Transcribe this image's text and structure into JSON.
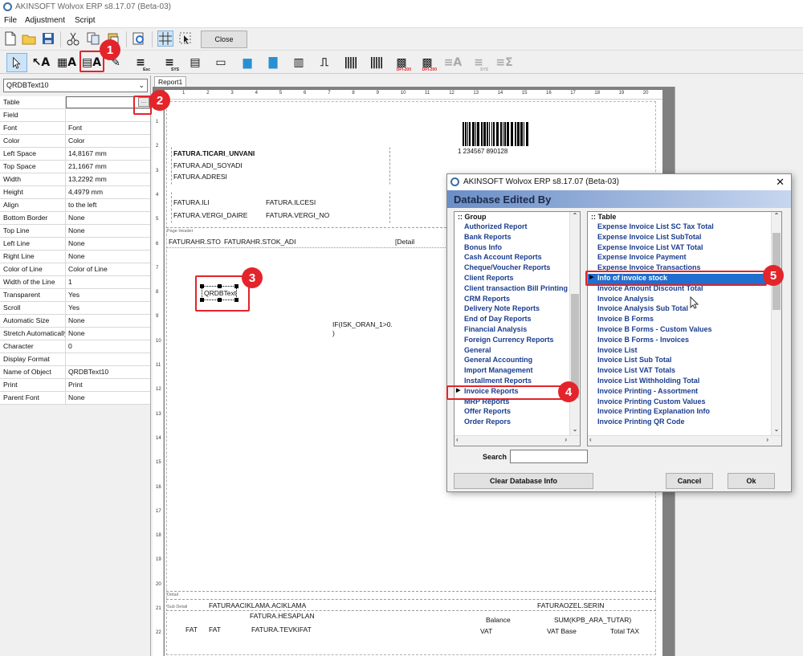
{
  "window": {
    "title": "AKINSOFT Wolvox ERP s8.17.07 (Beta-03)"
  },
  "menu": [
    "File",
    "Adjustment",
    "Script"
  ],
  "toolbar": {
    "close_label": "Close"
  },
  "palette": {
    "esc_sub": "Esc",
    "sys_sub": "SYS",
    "dpi_label": "DPI-200"
  },
  "object_selector": {
    "value": "QRDBText10"
  },
  "properties": [
    {
      "key": "Table",
      "value": ""
    },
    {
      "key": "Field",
      "value": ""
    },
    {
      "key": "Font",
      "value": "Font"
    },
    {
      "key": "Color",
      "value": "Color"
    },
    {
      "key": "Left Space",
      "value": "14,8167 mm"
    },
    {
      "key": "Top Space",
      "value": "21,1667 mm"
    },
    {
      "key": "Width",
      "value": "13,2292 mm"
    },
    {
      "key": "Height",
      "value": "4,4979 mm"
    },
    {
      "key": "Align",
      "value": "to the left"
    },
    {
      "key": "Bottom Border",
      "value": "None"
    },
    {
      "key": "Top Line",
      "value": "None"
    },
    {
      "key": "Left Line",
      "value": "None"
    },
    {
      "key": "Right Line",
      "value": "None"
    },
    {
      "key": "Color of Line",
      "value": "Color of Line"
    },
    {
      "key": "Width of the Line",
      "value": "1"
    },
    {
      "key": "Transparent",
      "value": "Yes"
    },
    {
      "key": "Scroll",
      "value": "Yes"
    },
    {
      "key": "Automatic Size",
      "value": "None"
    },
    {
      "key": "Stretch Automatically",
      "value": "None"
    },
    {
      "key": "Character",
      "value": "0"
    },
    {
      "key": "Display Format",
      "value": ""
    },
    {
      "key": "Name of Object",
      "value": "QRDBText10"
    },
    {
      "key": "Print",
      "value": "Print"
    },
    {
      "key": "Parent Font",
      "value": "None"
    }
  ],
  "report": {
    "tab": "Report1",
    "ruler_top": [
      "1",
      "2",
      "3",
      "4",
      "5",
      "6",
      "7",
      "8",
      "9",
      "10",
      "11",
      "12",
      "13",
      "14",
      "15",
      "16",
      "17",
      "18",
      "19",
      "20"
    ],
    "ruler_left": [
      "1",
      "2",
      "3",
      "4",
      "5",
      "6",
      "7",
      "8",
      "9",
      "10",
      "11",
      "12",
      "13",
      "14",
      "15",
      "16",
      "17",
      "18",
      "19",
      "20",
      "21",
      "22"
    ],
    "barcode_number": "1  234567  890128",
    "fields": {
      "ticari_unvani": "FATURA.TICARI_UNVANI",
      "adi_soyadi": "FATURA.ADI_SOYADI",
      "adresi": "FATURA.ADRESI",
      "ili": "FATURA.ILI",
      "ilcesi": "FATURA.ILCESI",
      "vergi_daire": "FATURA.VERGI_DAIRE",
      "vergi_no": "FATURA.VERGI_NO",
      "stok_kodu": "FATURAHR.STO",
      "stok_adi": "FATURAHR.STOK_ADI",
      "detail_col": "[Detail",
      "qrdbtext": "QRDBText",
      "if_expr_1": "IF(ISK_ORAN_1>0.",
      "if_expr_2": ")",
      "aciklama": "FATURAACIKLAMA.ACIKLAMA",
      "ozel_serin": "FATURAOZEL.SERIN",
      "hesaplan": "FATURA.HESAPLAN",
      "tevkifat": "FATURA.TEVKIFAT",
      "fat1": "FAT",
      "fat2": "FAT",
      "balance": "Balance",
      "sum": "SUM(KPB_ARA_TUTAR)",
      "vat": "VAT",
      "vat_base": "VAT Base",
      "total_tax": "Total TAX"
    },
    "bands": {
      "page_header": "Page Header",
      "detail": "Detail",
      "sub_detail": "Sub Detail"
    }
  },
  "dialog": {
    "title": "AKINSOFT Wolvox ERP s8.17.07 (Beta-03)",
    "header": "Database Edited By",
    "group_header": ":: Group",
    "table_header": ":: Table",
    "groups": [
      "Authorized Report",
      "Bank Reports",
      "Bonus Info",
      "Cash Account Reports",
      "Cheque/Voucher Reports",
      "Client Reports",
      "Client transaction Bill Printing",
      "CRM Reports",
      "Delivery Note Reports",
      "End of Day Reports",
      "Financial Analysis",
      "Foreign Currency Reports",
      "General",
      "General Accounting",
      "Import Management",
      "Installment Reports",
      "Invoice Reports",
      "MRP Reports",
      "Offer Reports",
      "Order Repors"
    ],
    "selected_group": "Invoice Reports",
    "tables": [
      "Expense Invoice List SC Tax Total",
      "Expense Invoice List SubTotal",
      "Expense Invoice List VAT Total",
      "Expense Invoice Payment",
      "Expense Invoice Transactions",
      "Info of invoice stock",
      "Invoice Amount Discount Total",
      "Invoice Analysis",
      "Invoice Analysis Sub Total",
      "Invoice B Forms",
      "Invoice B Forms - Custom Values",
      "Invoice B Forms - Invoices",
      "Invoice List",
      "Invoice List Sub Total",
      "Invoice List VAT Totals",
      "Invoice List Withholding Total",
      "Invoice Printing - Assortment",
      "Invoice Printing Custom Values",
      "Invoice Printing Explanation Info",
      "Invoice Printing QR Code"
    ],
    "selected_table": "Info of invoice stock",
    "search_label": "Search",
    "search_value": "",
    "clear_label": "Clear Database Info",
    "cancel_label": "Cancel",
    "ok_label": "Ok"
  },
  "annotations": [
    "1",
    "2",
    "3",
    "4",
    "5"
  ],
  "colors": {
    "callout": "#e3242b",
    "selection": "#1e6fd0",
    "list_text": "#1a3d8f"
  }
}
